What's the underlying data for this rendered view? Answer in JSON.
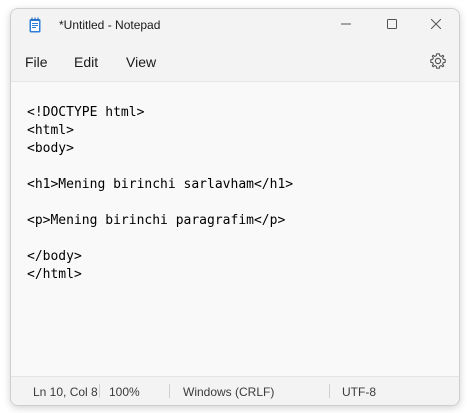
{
  "window": {
    "title": "*Untitled - Notepad",
    "app_icon": "notepad-icon"
  },
  "window_controls": {
    "minimize_icon": "minimize-icon",
    "maximize_icon": "maximize-icon",
    "close_icon": "close-icon"
  },
  "menu": {
    "items": [
      {
        "label": "File"
      },
      {
        "label": "Edit"
      },
      {
        "label": "View"
      }
    ],
    "settings_icon": "gear-icon"
  },
  "editor": {
    "lines": [
      "<!DOCTYPE html>",
      "<html>",
      "<body>",
      "",
      "<h1>Mening birinchi sarlavham</h1>",
      "",
      "<p>Mening birinchi paragrafim</p>",
      "",
      "</body>",
      "</html>"
    ]
  },
  "status": {
    "position": "Ln 10, Col 8",
    "zoom": "100%",
    "line_endings": "Windows (CRLF)",
    "encoding": "UTF-8"
  }
}
